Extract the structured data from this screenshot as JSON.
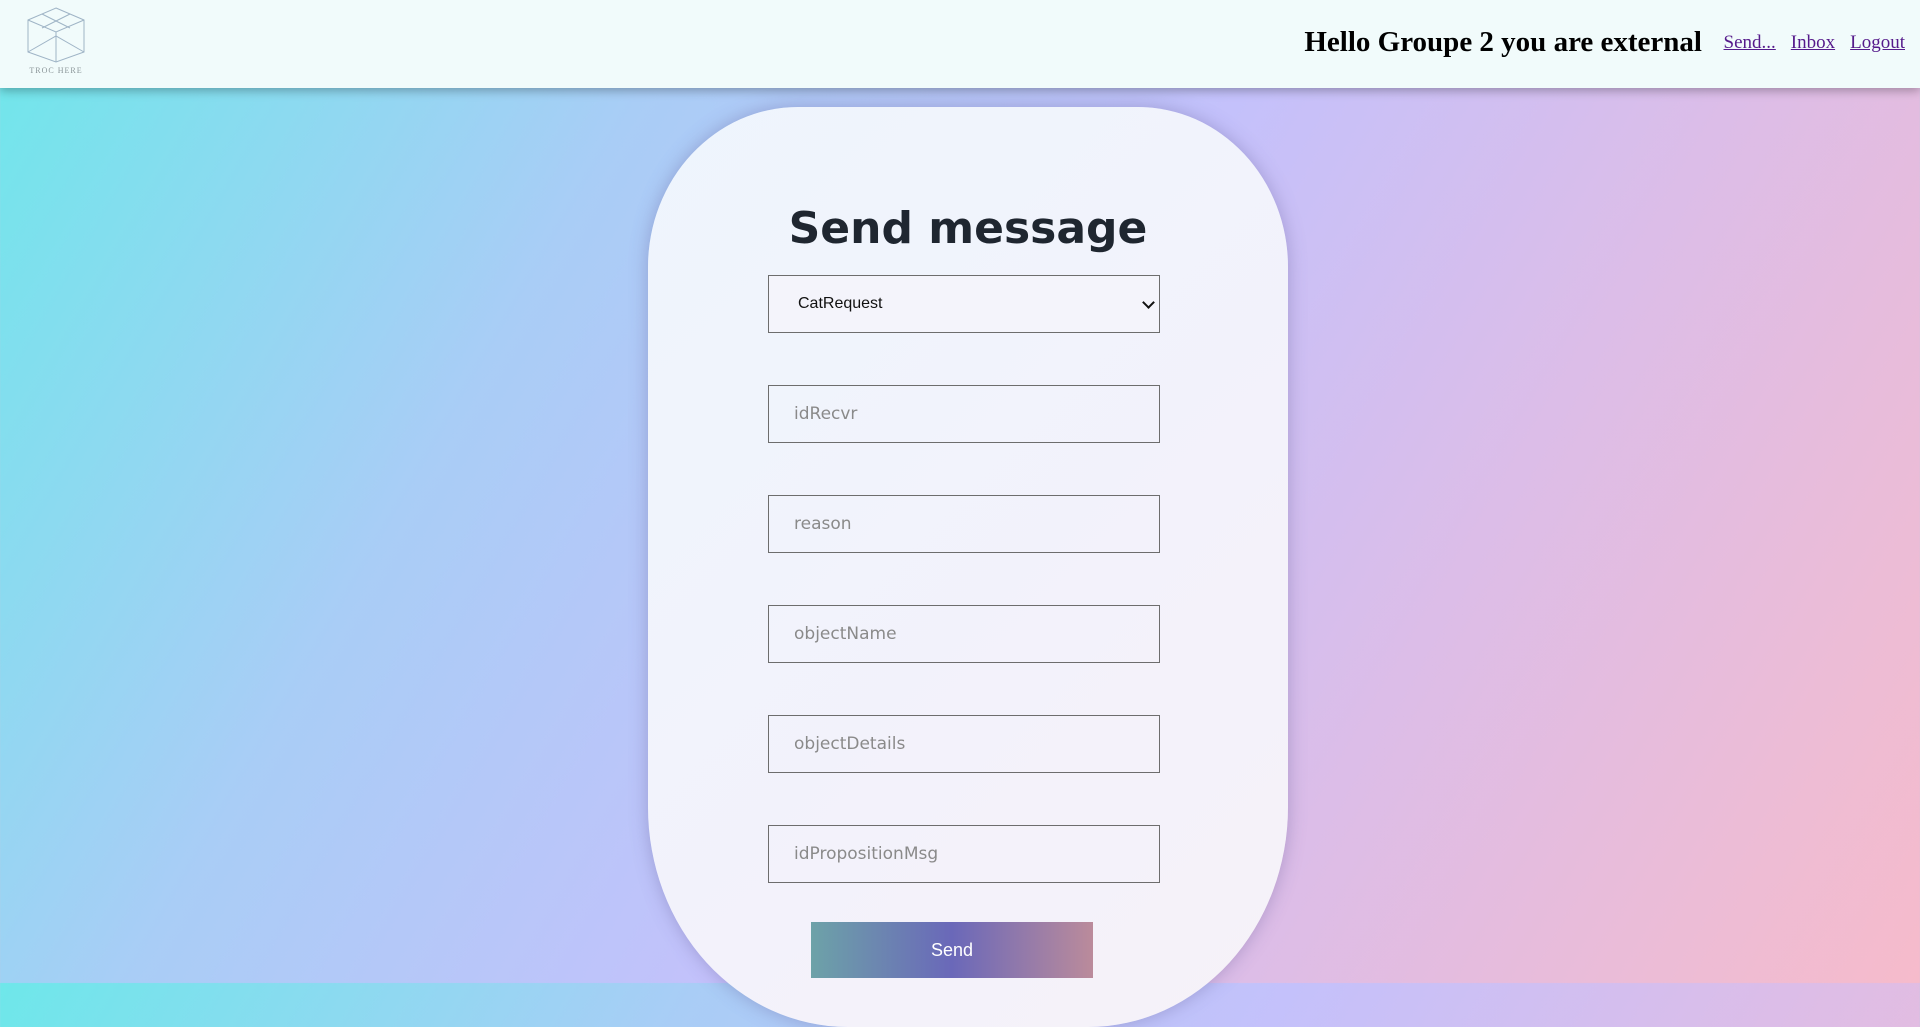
{
  "header": {
    "logo_text": "TROC HERE",
    "greeting": "Hello Groupe 2 you are external",
    "nav": [
      "Send...",
      "Inbox",
      "Logout"
    ]
  },
  "form": {
    "title": "Send message",
    "message_type": "CatRequest",
    "fields": [
      {
        "placeholder": "idRecvr",
        "value": ""
      },
      {
        "placeholder": "reason",
        "value": ""
      },
      {
        "placeholder": "objectName",
        "value": ""
      },
      {
        "placeholder": "objectDetails",
        "value": ""
      },
      {
        "placeholder": "idPropositionMsg",
        "value": ""
      }
    ],
    "submit_label": "Send"
  },
  "colors": {
    "link": "#551a8b",
    "button_gradient": [
      "#6da2a8",
      "#6a68b9",
      "#bb8b9b"
    ]
  }
}
